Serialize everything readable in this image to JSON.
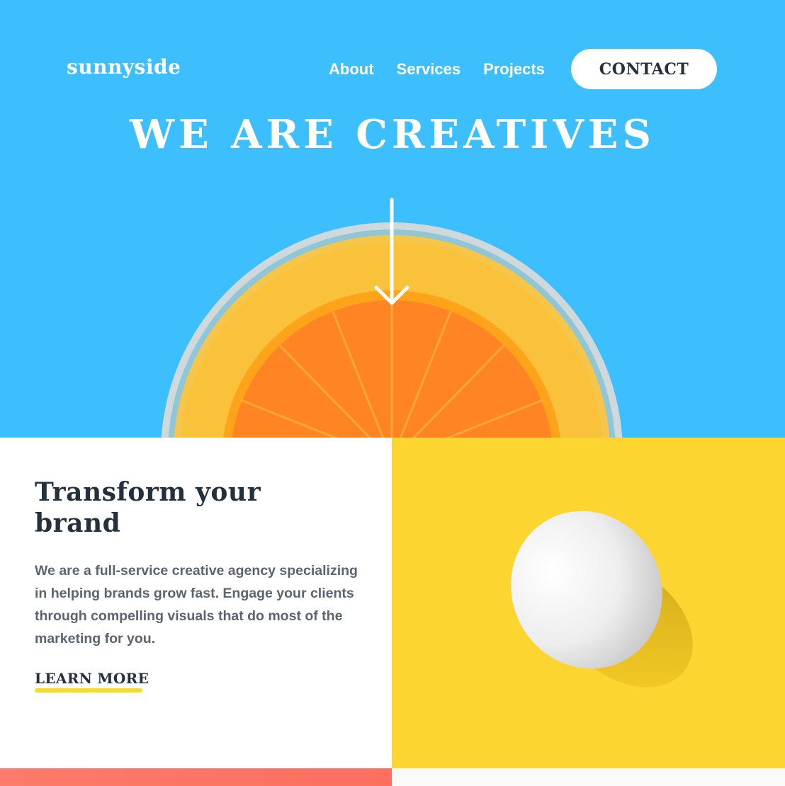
{
  "header": {
    "logo": "sunnyside",
    "nav": [
      "About",
      "Services",
      "Projects"
    ],
    "contact_label": "CONTACT"
  },
  "hero": {
    "title": "WE ARE CREATIVES",
    "scroll_icon": "arrow-down-icon",
    "image": "orange-slice-in-glass"
  },
  "feature": {
    "title": "Transform your brand",
    "description": "We are a full-service creative agency specializing in helping brands grow fast. Engage your clients through compelling visuals that do most of the marketing for you.",
    "link_label": "LEARN MORE",
    "image": "white-egg-on-yellow"
  },
  "colors": {
    "hero_bg": "#3ebffd",
    "feature_img_bg": "#fdd530",
    "heading": "#23303e",
    "body_text": "#5b6471",
    "underline": "#fad400",
    "bottom_strip": "#fe6f60"
  }
}
